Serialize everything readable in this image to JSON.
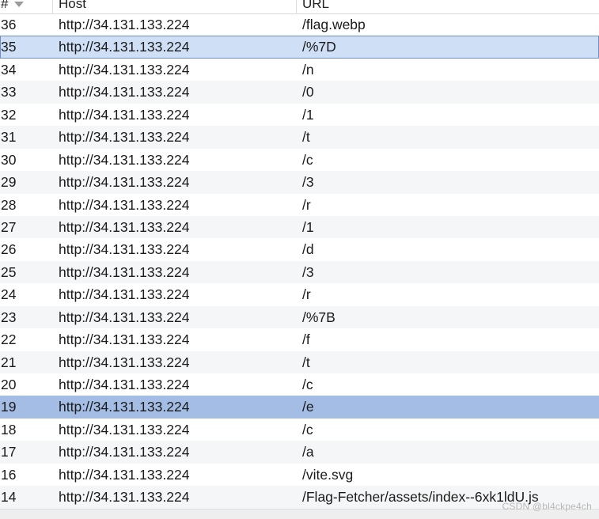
{
  "columns": {
    "num": "#",
    "host": "Host",
    "url": "URL"
  },
  "rows": [
    {
      "num": "36",
      "host": "http://34.131.133.224",
      "url": "/flag.webp"
    },
    {
      "num": "35",
      "host": "http://34.131.133.224",
      "url": "/%7D"
    },
    {
      "num": "34",
      "host": "http://34.131.133.224",
      "url": "/n"
    },
    {
      "num": "33",
      "host": "http://34.131.133.224",
      "url": "/0"
    },
    {
      "num": "32",
      "host": "http://34.131.133.224",
      "url": "/1"
    },
    {
      "num": "31",
      "host": "http://34.131.133.224",
      "url": "/t"
    },
    {
      "num": "30",
      "host": "http://34.131.133.224",
      "url": "/c"
    },
    {
      "num": "29",
      "host": "http://34.131.133.224",
      "url": "/3"
    },
    {
      "num": "28",
      "host": "http://34.131.133.224",
      "url": "/r"
    },
    {
      "num": "27",
      "host": "http://34.131.133.224",
      "url": "/1"
    },
    {
      "num": "26",
      "host": "http://34.131.133.224",
      "url": "/d"
    },
    {
      "num": "25",
      "host": "http://34.131.133.224",
      "url": "/3"
    },
    {
      "num": "24",
      "host": "http://34.131.133.224",
      "url": "/r"
    },
    {
      "num": "23",
      "host": "http://34.131.133.224",
      "url": "/%7B"
    },
    {
      "num": "22",
      "host": "http://34.131.133.224",
      "url": "/f"
    },
    {
      "num": "21",
      "host": "http://34.131.133.224",
      "url": "/t"
    },
    {
      "num": "20",
      "host": "http://34.131.133.224",
      "url": "/c"
    },
    {
      "num": "19",
      "host": "http://34.131.133.224",
      "url": "/e"
    },
    {
      "num": "18",
      "host": "http://34.131.133.224",
      "url": "/c"
    },
    {
      "num": "17",
      "host": "http://34.131.133.224",
      "url": "/a"
    },
    {
      "num": "16",
      "host": "http://34.131.133.224",
      "url": "/vite.svg"
    },
    {
      "num": "14",
      "host": "http://34.131.133.224",
      "url": "/Flag-Fetcher/assets/index--6xk1ldU.js"
    }
  ],
  "selection": {
    "focused_row": "35",
    "selected_row": "19"
  },
  "watermark": "CSDN @bl4ckpe4ch",
  "colors": {
    "selected": "#a3bde4",
    "focused": "#cfe0f6",
    "alternate": "#f5f6f7"
  },
  "icons": {
    "sort": "sort-down-icon"
  }
}
